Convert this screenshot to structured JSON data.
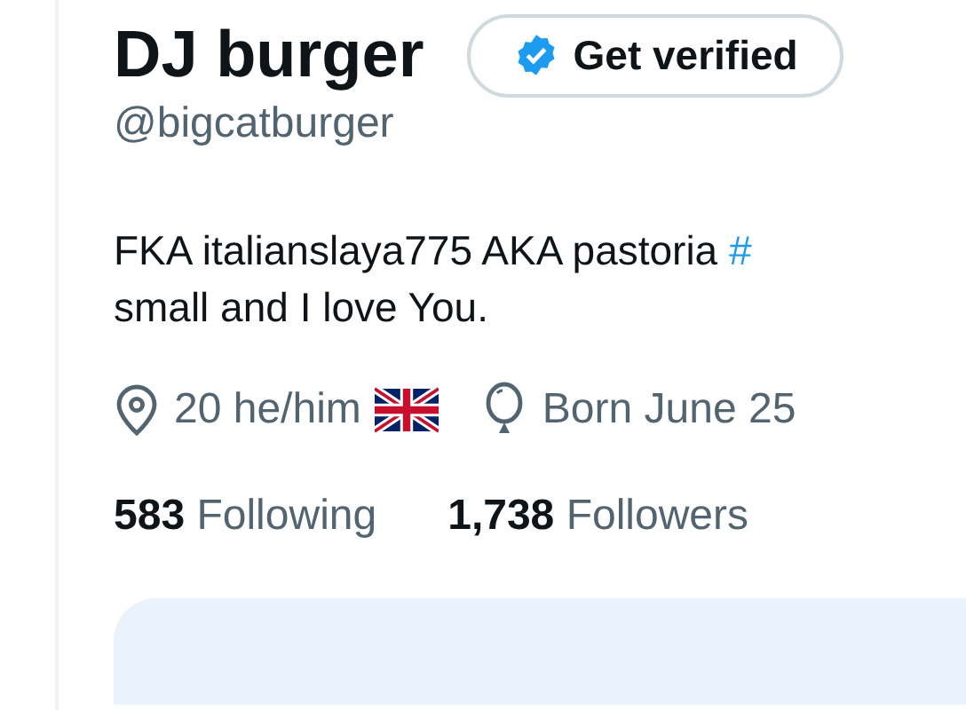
{
  "profile": {
    "name": "DJ burger",
    "verify_button": {
      "label": "Get verified"
    },
    "handle": "@bigcatburger",
    "bio_lines": [
      [
        {
          "kind": "text",
          "text": "FKA italianslaya775 AKA pastoria "
        },
        {
          "kind": "hashtag",
          "text": "#"
        }
      ],
      [
        {
          "kind": "text",
          "text": "small and I love You."
        }
      ]
    ],
    "meta": [
      {
        "kind": "location",
        "text": "20 he/him",
        "flag": true
      },
      {
        "kind": "birthday",
        "text": "Born June 25",
        "flag": false
      }
    ],
    "stats": [
      {
        "count": "583",
        "label": "Following"
      },
      {
        "count": "1,738",
        "label": "Followers"
      }
    ]
  }
}
